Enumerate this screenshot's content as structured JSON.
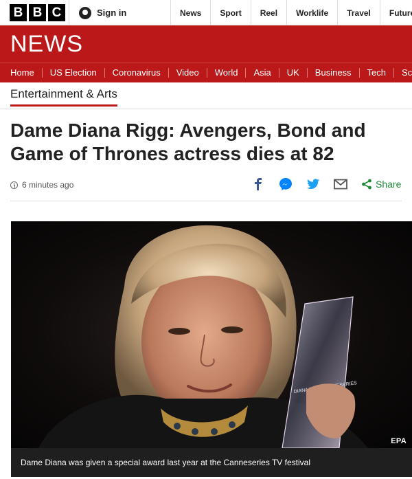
{
  "brand": {
    "letters": [
      "B",
      "B",
      "C"
    ]
  },
  "signin": {
    "label": "Sign in"
  },
  "top_nav": [
    "News",
    "Sport",
    "Reel",
    "Worklife",
    "Travel",
    "Future"
  ],
  "news_banner": {
    "wordmark": "NEWS"
  },
  "sub_nav": [
    "Home",
    "US Election",
    "Coronavirus",
    "Video",
    "World",
    "Asia",
    "UK",
    "Business",
    "Tech",
    "Scie"
  ],
  "section": {
    "label": "Entertainment & Arts"
  },
  "article": {
    "headline": "Dame Diana Rigg: Avengers, Bond and Game of Thrones actress dies at 82",
    "timestamp": "6 minutes ago",
    "share_label": "Share",
    "share_icons": [
      "facebook-icon",
      "messenger-icon",
      "twitter-icon",
      "email-icon",
      "share-icon"
    ]
  },
  "image": {
    "credit": "EPA",
    "caption": "Dame Diana was given a special award last year at the Canneseries TV festival",
    "trophy_engraving": "DIANA RIGG CANNESERIES"
  },
  "colors": {
    "brand_red": "#bb1919",
    "share_green": "#1d8a36",
    "facebook_blue": "#3b5998",
    "messenger_blue": "#0084ff",
    "twitter_blue": "#1da1f2"
  }
}
